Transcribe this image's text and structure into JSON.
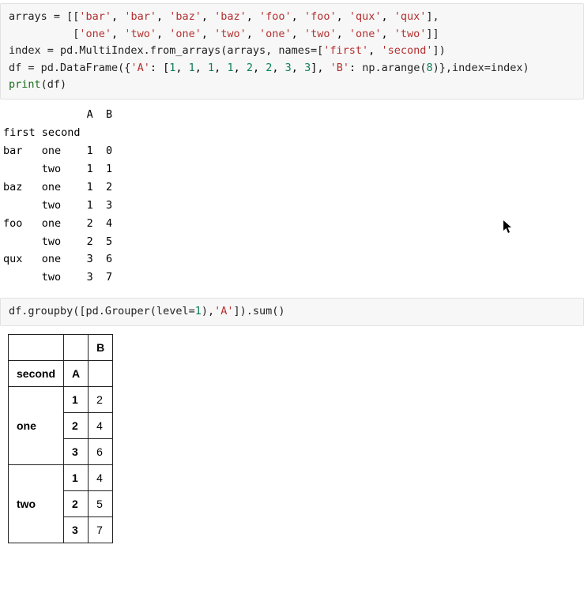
{
  "code_cell_1": {
    "line1_pre": "arrays = [[",
    "line1_items": [
      "'bar'",
      "'bar'",
      "'baz'",
      "'baz'",
      "'foo'",
      "'foo'",
      "'qux'",
      "'qux'"
    ],
    "line1_post": "],",
    "line2_pad": "          [",
    "line2_items": [
      "'one'",
      "'two'",
      "'one'",
      "'two'",
      "'one'",
      "'two'",
      "'one'",
      "'two'"
    ],
    "line2_post": "]]",
    "line3_a": "index = pd.MultiIndex.from_arrays(arrays, names=[",
    "line3_s1": "'first'",
    "line3_s2": "'second'",
    "line3_b": "])",
    "line4_a": "df = pd.DataFrame({",
    "line4_keyA": "'A'",
    "line4_valsA": [
      "1",
      "1",
      "1",
      "1",
      "2",
      "2",
      "3",
      "3"
    ],
    "line4_keyB": "'B'",
    "line4_arange": "np.arange(",
    "line4_arange_n": "8",
    "line4_b": ")},index=index)",
    "line5_call": "print",
    "line5_arg": "(df)"
  },
  "output_1": {
    "header": "             A  B",
    "subheader": "first second",
    "rows": [
      "bar   one    1  0",
      "      two    1  1",
      "baz   one    1  2",
      "      two    1  3",
      "foo   one    2  4",
      "      two    2  5",
      "qux   one    3  6",
      "      two    3  7"
    ]
  },
  "code_cell_2": {
    "line1_a": "df.groupby([pd.Grouper(level=",
    "line1_n": "1",
    "line1_b": "),",
    "line1_s": "'A'",
    "line1_c": "]).sum()"
  },
  "table2": {
    "col_B": "B",
    "idx_second": "second",
    "idx_A": "A",
    "groups": [
      {
        "name": "one",
        "rows": [
          {
            "A": "1",
            "B": "2"
          },
          {
            "A": "2",
            "B": "4"
          },
          {
            "A": "3",
            "B": "6"
          }
        ]
      },
      {
        "name": "two",
        "rows": [
          {
            "A": "1",
            "B": "4"
          },
          {
            "A": "2",
            "B": "5"
          },
          {
            "A": "3",
            "B": "7"
          }
        ]
      }
    ]
  },
  "cursor_glyph": "➤"
}
